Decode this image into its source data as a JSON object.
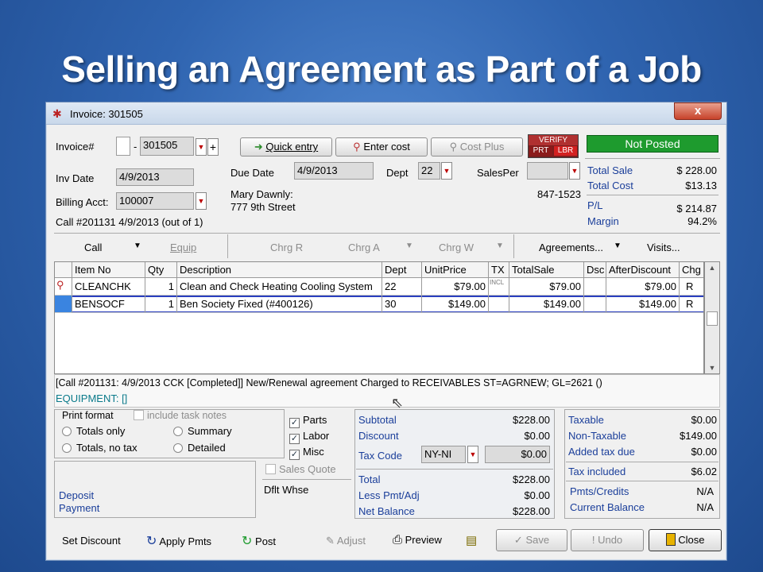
{
  "slide_title": "Selling an Agreement  as Part of a Job",
  "window": {
    "title": "Invoice: 301505",
    "close_symbol": "x"
  },
  "invoice": {
    "invoice_label": "Invoice#",
    "invoice_prefix": "",
    "invoice_dash": "-",
    "invoice_number": "301505",
    "inv_date_label": "Inv Date",
    "inv_date": "4/9/2013",
    "billing_acct_label": "Billing Acct:",
    "billing_acct": "100007",
    "call_info": "Call #201131 4/9/2013 (out of 1)",
    "due_date_label": "Due Date",
    "due_date": "4/9/2013",
    "dept_label": "Dept",
    "dept": "22",
    "salesper_label": "SalesPer",
    "salesper": "",
    "customer_name": "Mary Dawnly:",
    "customer_address": "777 9th Street",
    "phone": "847-1523"
  },
  "toolbar": {
    "quick_entry": "Quick entry",
    "enter_cost": "Enter cost",
    "cost_plus": "Cost Plus",
    "verify": "VERIFY",
    "prt": "PRT",
    "lbr": "LBR"
  },
  "status": "Not Posted",
  "summary": {
    "total_sale_label": "Total Sale",
    "total_sale": "$ 228.00",
    "total_cost_label": "Total Cost",
    "total_cost": "$13.13",
    "pl_label": "P/L",
    "pl": "$ 214.87",
    "margin_label": "Margin",
    "margin": "94.2%"
  },
  "tabs": {
    "call": "Call",
    "equip": "Equip",
    "chrg_r": "Chrg R",
    "chrg_a": "Chrg A",
    "chrg_w": "Chrg W",
    "agreements": "Agreements...",
    "visits": "Visits..."
  },
  "table": {
    "headers": [
      "Item No",
      "Qty",
      "Description",
      "Dept",
      "UnitPrice",
      "TX",
      "TotalSale",
      "Dsc",
      "AfterDiscount",
      "Chg"
    ],
    "rows": [
      [
        "CLEANCHK",
        "1",
        "Clean and Check Heating Cooling System",
        "22",
        "$79.00",
        "INCL",
        "$79.00",
        "",
        "$79.00",
        "R"
      ],
      [
        "BENSOCF",
        "1",
        "Ben Society Fixed (#400126)",
        "30",
        "$149.00",
        "",
        "$149.00",
        "",
        "$149.00",
        "R"
      ]
    ]
  },
  "memo": {
    "line1": "[Call #201131: 4/9/2013 CCK [Completed]]   New/Renewal agreement Charged to RECEIVABLES ST=AGRNEW; GL=2621 ()",
    "line2": "EQUIPMENT: []"
  },
  "print_format": {
    "label": "Print format",
    "include_task_notes": "include task notes",
    "totals_only": "Totals only",
    "summary": "Summary",
    "totals_no_tax": "Totals, no tax",
    "detailed": "Detailed"
  },
  "deposit": {
    "line1": "Deposit",
    "line2": "Payment"
  },
  "checks": {
    "parts": "Parts",
    "labor": "Labor",
    "misc": "Misc",
    "sales_quote": "Sales Quote",
    "dflt_whse": "Dflt Whse"
  },
  "totals": {
    "subtotal_label": "Subtotal",
    "subtotal": "$228.00",
    "discount_label": "Discount",
    "discount": "$0.00",
    "tax_code_label": "Tax Code",
    "tax_code": "NY-NI",
    "tax_amount": "$0.00",
    "total_label": "Total",
    "total": "$228.00",
    "less_pmt_label": "Less Pmt/Adj",
    "less_pmt": "$0.00",
    "net_balance_label": "Net Balance",
    "net_balance": "$228.00"
  },
  "tax_panel": {
    "taxable_label": "Taxable",
    "taxable": "$0.00",
    "non_taxable_label": "Non-Taxable",
    "non_taxable": "$149.00",
    "added_tax_label": "Added tax due",
    "added_tax": "$0.00",
    "tax_included_label": "Tax included",
    "tax_included": "$6.02",
    "pmts_credits_label": "Pmts/Credits",
    "pmts_credits": "N/A",
    "current_balance_label": "Current Balance",
    "current_balance": "N/A"
  },
  "bottom": {
    "set_discount": "Set Discount",
    "apply_pmts": "Apply Pmts",
    "post": "Post",
    "adjust": "Adjust",
    "preview": "Preview",
    "save": "Save",
    "undo": "Undo",
    "close": "Close"
  },
  "colors": {
    "status_green": "#1e9b2e",
    "background_blue": "#2f64b0",
    "verify_red": "#c0392b",
    "row_select_blue": "#2a5bd7"
  }
}
